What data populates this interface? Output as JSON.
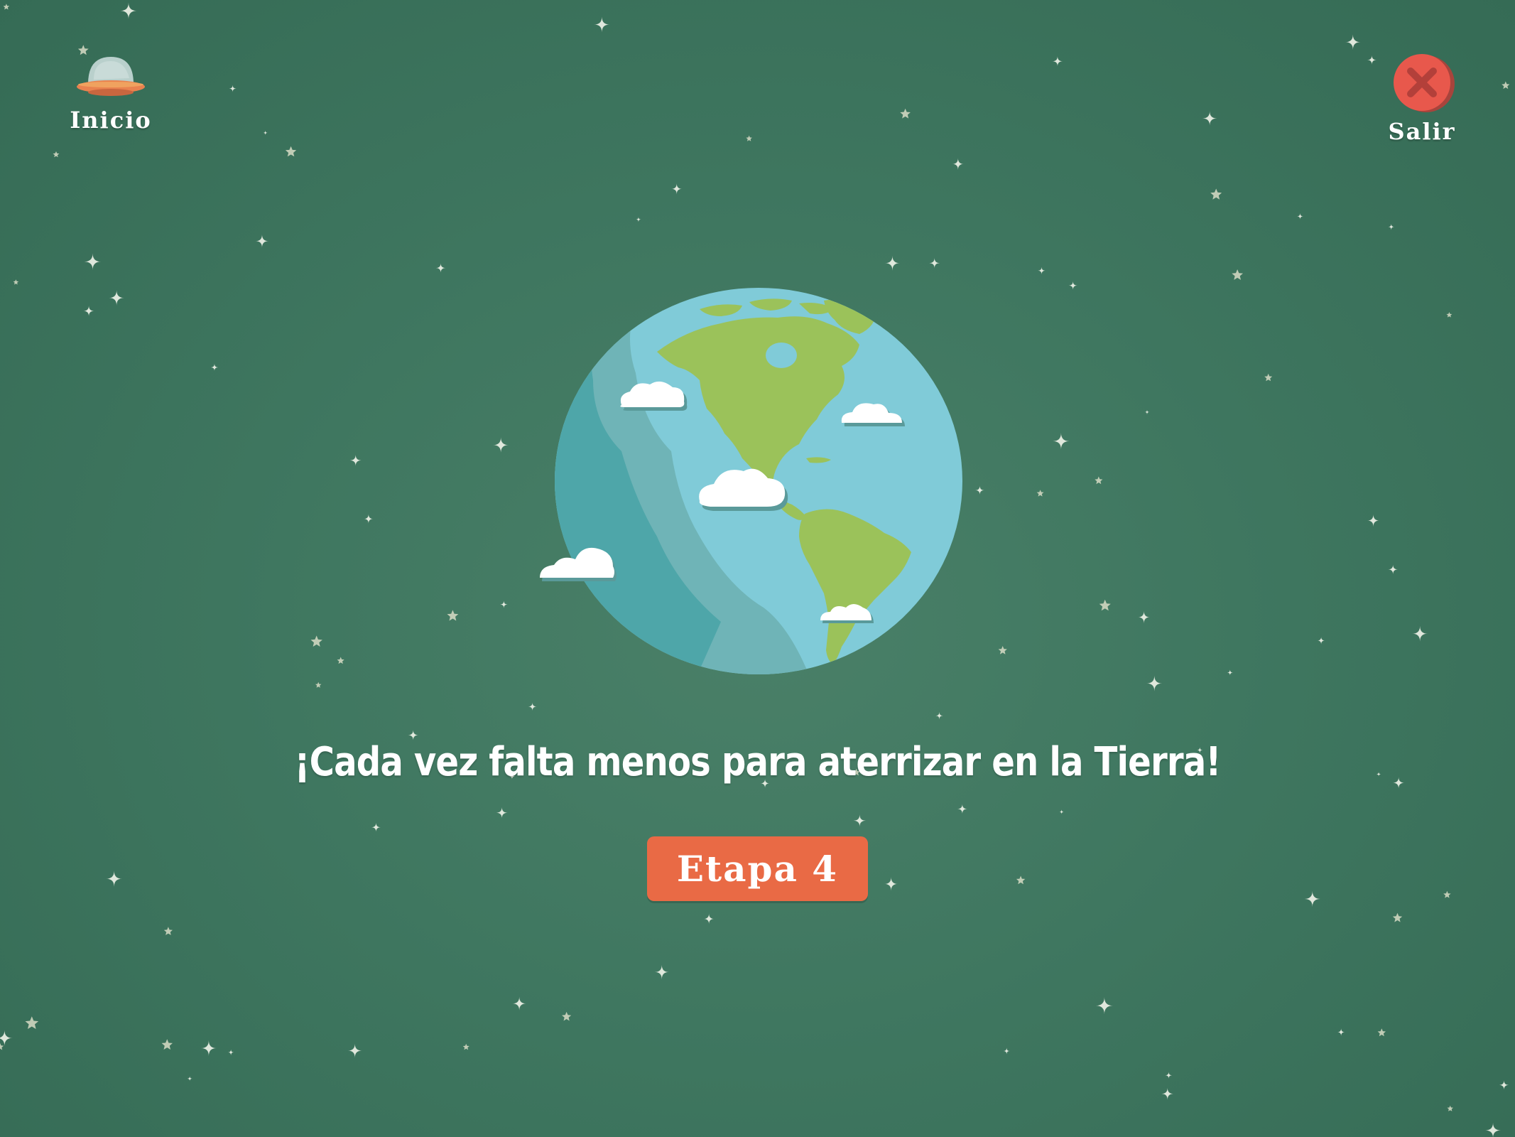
{
  "nav": {
    "home_label": "Inicio",
    "exit_label": "Salir"
  },
  "main": {
    "message": "¡Cada vez falta menos para aterrizar en la Tierra!",
    "stage_button_label": "Etapa 4"
  },
  "colors": {
    "background": "#3f7760",
    "stage_button": "#e96a45",
    "exit_button": "#e8584c",
    "ocean": "#80cbd8",
    "land": "#9bc25a"
  },
  "icons": {
    "home": "ufo-icon",
    "exit": "close-icon",
    "illustration": "earth-globe"
  }
}
